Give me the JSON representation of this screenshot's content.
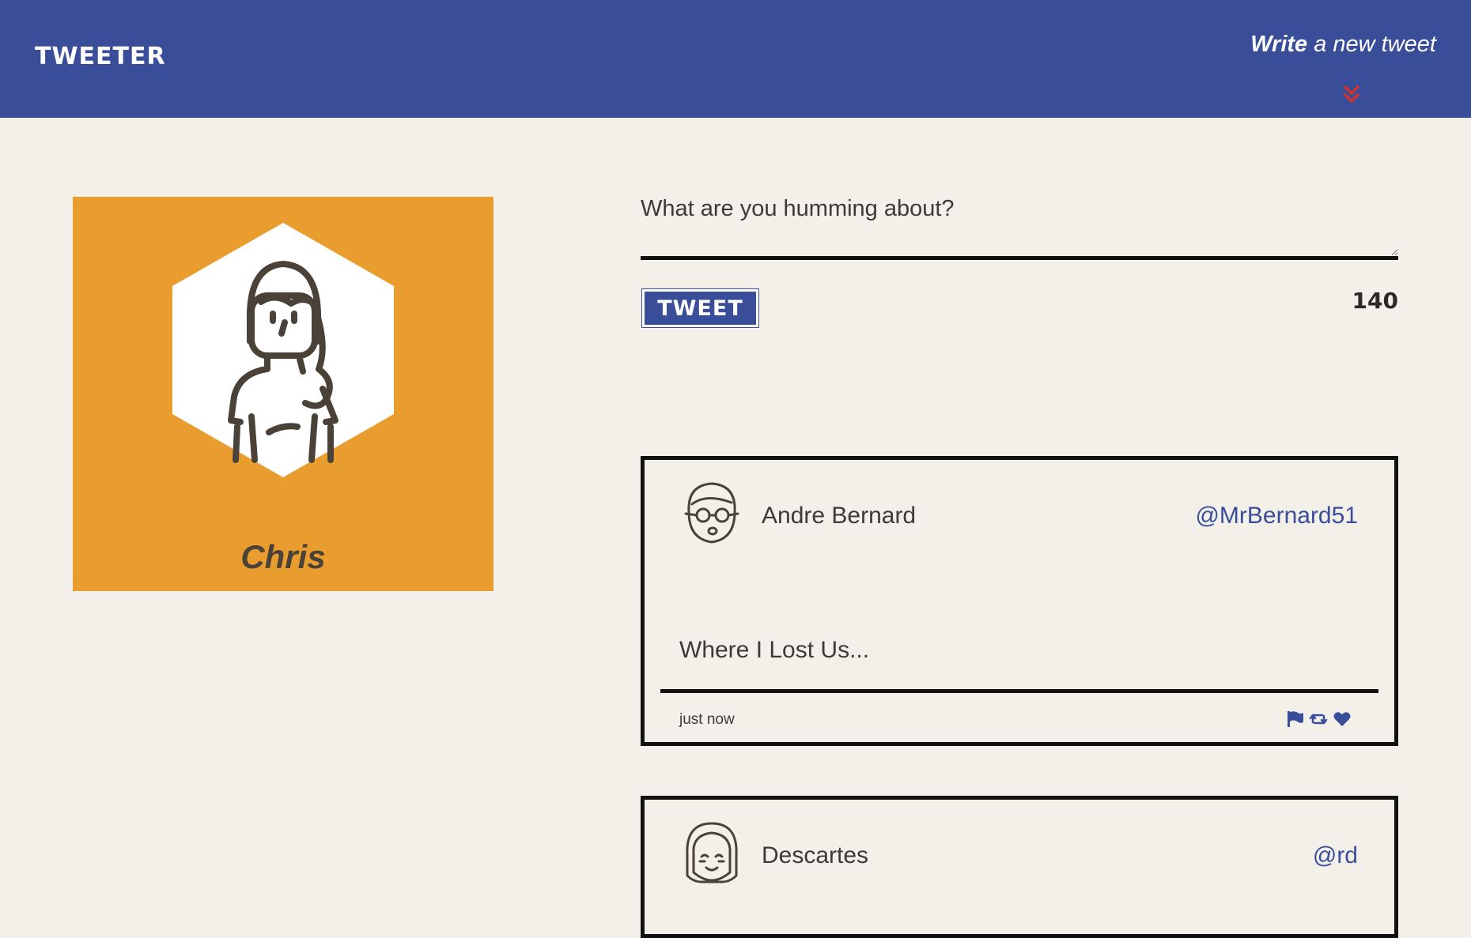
{
  "nav": {
    "brand": "TWEETER",
    "compose_bold": "Write",
    "compose_rest": " a new tweet"
  },
  "profile": {
    "name": "Chris",
    "color": "#e99d2f"
  },
  "composer": {
    "placeholder": "What are you humming about?",
    "button_label": "TWEET",
    "counter": "140"
  },
  "tweets": [
    {
      "name": "Andre Bernard",
      "handle": "@MrBernard51",
      "body": "Where I Lost Us...",
      "time": "just now"
    },
    {
      "name": "Descartes",
      "handle": "@rd"
    }
  ],
  "colors": {
    "nav": "#3a4d98",
    "accent": "#d1332b",
    "background": "#f3f0ea"
  },
  "icons": {
    "chevron": "double-chevron-down-icon",
    "flag": "flag-icon",
    "retweet": "retweet-icon",
    "like": "heart-icon"
  }
}
